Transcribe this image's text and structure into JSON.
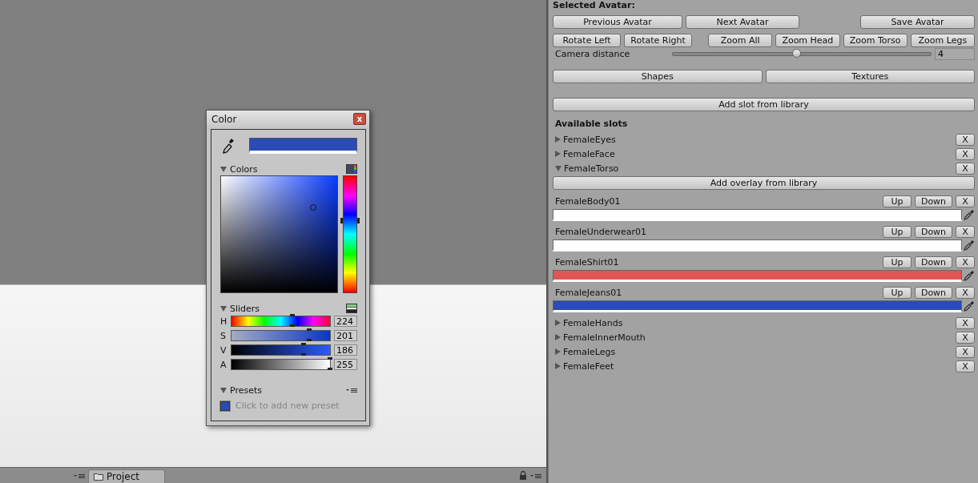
{
  "viewport": {
    "tab": "Project"
  },
  "color_picker": {
    "title": "Color",
    "close": "x",
    "current_swatch": {
      "color": "#2a4cb4"
    },
    "colors_section": {
      "label": "Colors",
      "expanded": true
    },
    "sliders_section": {
      "label": "Sliders",
      "expanded": true
    },
    "sliders": [
      {
        "channel": "H",
        "level": 0.62,
        "value": "224",
        "kind": "hue"
      },
      {
        "channel": "S",
        "level": 0.79,
        "value": "201",
        "kind": "saturation"
      },
      {
        "channel": "V",
        "level": 0.73,
        "value": "186",
        "kind": "value"
      },
      {
        "channel": "A",
        "level": 1.0,
        "value": "255",
        "kind": "alpha"
      }
    ],
    "presets_section": {
      "label": "Presets",
      "expanded": true
    },
    "preset_placeholder": "Click to add new preset",
    "presets": [
      {
        "color": "#2a4cb4"
      }
    ]
  },
  "inspector": {
    "header": "Selected Avatar:",
    "button_rows": [
      [
        [
          "Previous Avatar",
          "Next Avatar"
        ],
        [
          "Save Avatar"
        ]
      ],
      [
        [
          "Rotate Left",
          "Rotate Right"
        ],
        [
          "Zoom All",
          "Zoom Head",
          "Zoom Torso",
          "Zoom Legs"
        ]
      ]
    ],
    "camera_distance": {
      "label": "Camera distance",
      "level": 0.48,
      "value": "4"
    },
    "mode_buttons": [
      "Shapes",
      "Textures"
    ],
    "add_slot_button": "Add slot from library",
    "slots_title": "Available slots",
    "slots": [
      {
        "name": "FemaleEyes",
        "expanded": false,
        "remove": "X"
      },
      {
        "name": "FemaleFace",
        "expanded": false,
        "remove": "X"
      },
      {
        "name": "FemaleTorso",
        "expanded": true,
        "remove": "X",
        "add_overlay_button": "Add overlay from library",
        "overlays": [
          {
            "name": "FemaleBody01",
            "color": "#ffffff",
            "buttons": [
              "Up",
              "Down",
              "X"
            ]
          },
          {
            "name": "FemaleUnderwear01",
            "color": "#ffffff",
            "buttons": [
              "Up",
              "Down",
              "X"
            ]
          },
          {
            "name": "FemaleShirt01",
            "color": "#e05555",
            "buttons": [
              "Up",
              "Down",
              "X"
            ]
          },
          {
            "name": "FemaleJeans01",
            "color": "#2a4cb4",
            "buttons": [
              "Up",
              "Down",
              "X"
            ]
          }
        ]
      },
      {
        "name": "FemaleHands",
        "expanded": false,
        "remove": "X"
      },
      {
        "name": "FemaleInnerMouth",
        "expanded": false,
        "remove": "X"
      },
      {
        "name": "FemaleLegs",
        "expanded": false,
        "remove": "X"
      },
      {
        "name": "FemaleFeet",
        "expanded": false,
        "remove": "X"
      }
    ]
  }
}
